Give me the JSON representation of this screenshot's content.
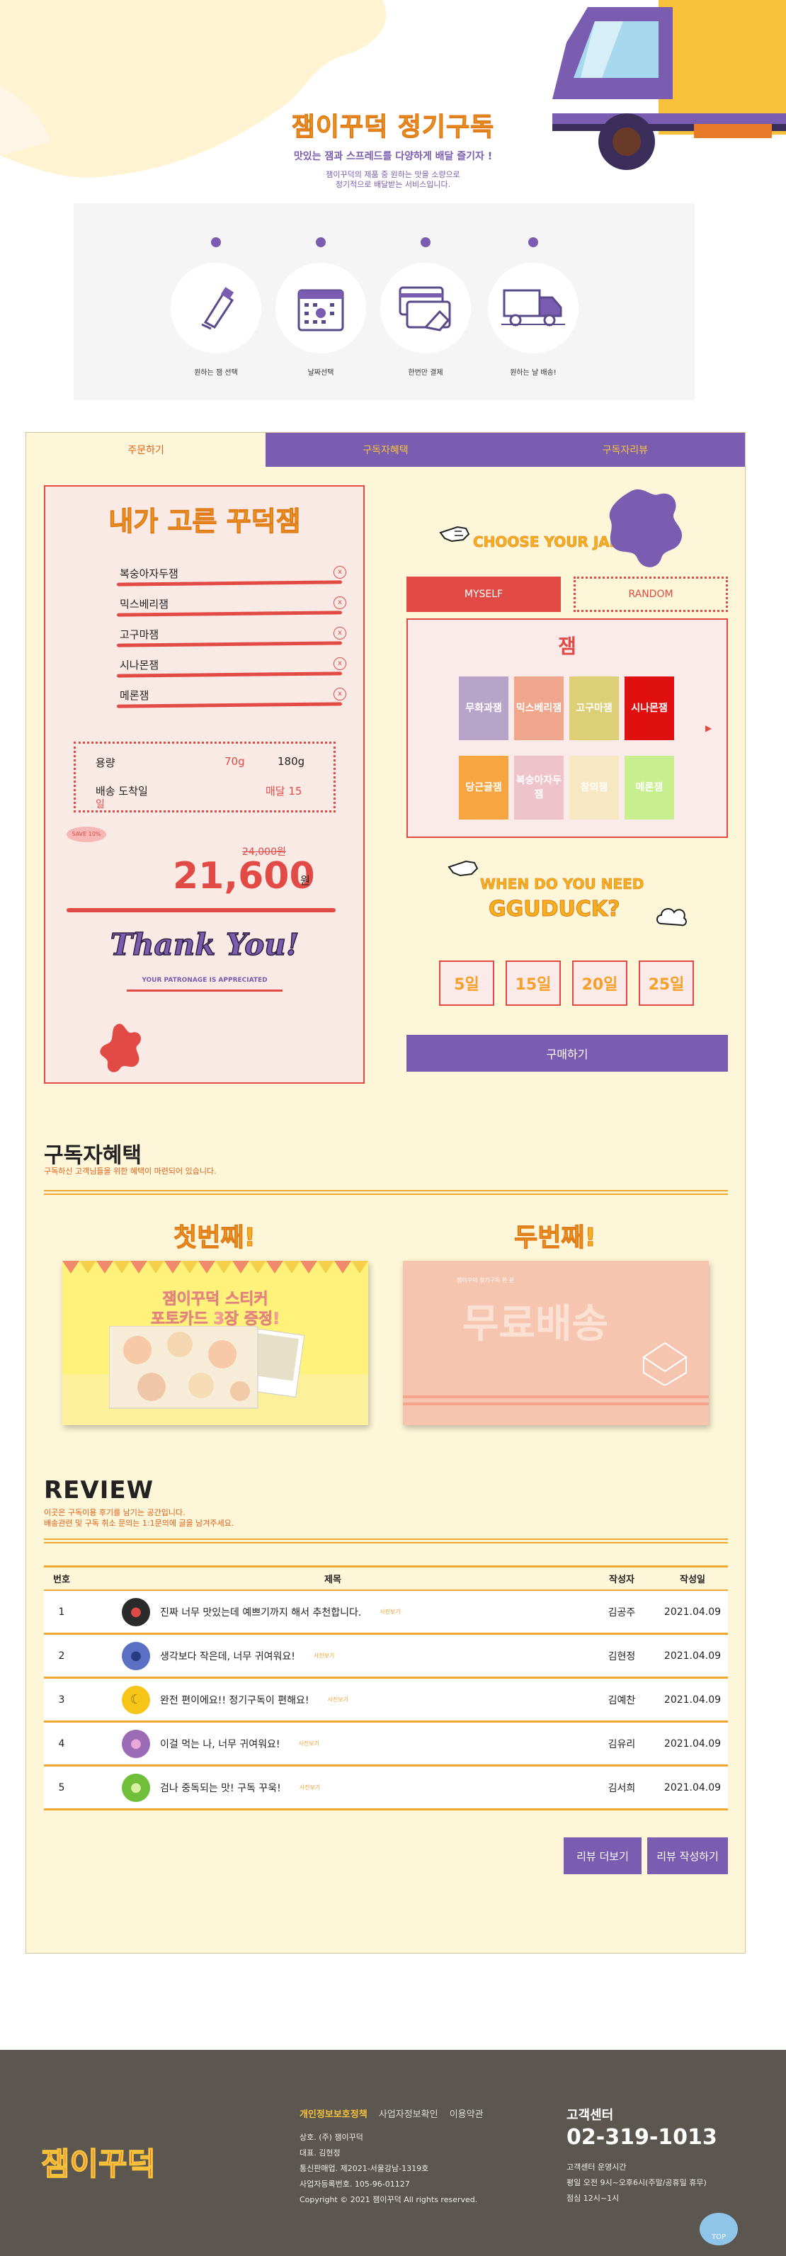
{
  "hero": {
    "title": "잼이꾸덕 정기구독",
    "subtitle": "맛있는 잼과 스프레드를 다양하게 배달 즐기자 !",
    "desc1": "잼이꾸덕의 제품 중 원하는 맛을 소량으로",
    "desc2": "정기적으로 배달받는 서비스입니다."
  },
  "steps": [
    {
      "label": "원하는 잼 선택",
      "icon": "jam-tube-icon"
    },
    {
      "label": "날짜선택",
      "icon": "calendar-icon"
    },
    {
      "label": "한번만 결제",
      "icon": "card-payment-icon"
    },
    {
      "label": "원하는 날 배송!",
      "icon": "truck-icon"
    }
  ],
  "tabs": [
    "주문하기",
    "구독자혜택",
    "구독자리뷰"
  ],
  "order": {
    "card_title": "내가 고른 꾸덕잼",
    "selected": [
      "복숭아자두잼",
      "믹스베리잼",
      "고구마잼",
      "시나몬잼",
      "메론잼"
    ],
    "remove_symbol": "x",
    "capacity_label": "용량",
    "capacity_options": [
      "70g",
      "180g"
    ],
    "delivery_label": "배송 도착일",
    "delivery_value": "매달 15",
    "delivery_unit": "일",
    "save_badge": "SAVE 10%",
    "old_price": "24,000원",
    "price": "21,600",
    "currency": "원",
    "thanks": "Thank You!",
    "thanks_sub": "YOUR PATRONAGE IS APPRECIATED"
  },
  "choose": {
    "title": "CHOOSE YOUR JAM",
    "myself": "MYSELF",
    "random": "RANDOM",
    "box_title": "잼",
    "jams": [
      {
        "label": "무화과잼",
        "color": "#b7a5c9"
      },
      {
        "label": "믹스베리잼",
        "color": "#f0a68c"
      },
      {
        "label": "고구마잼",
        "color": "#dccf78"
      },
      {
        "label": "시나몬잼",
        "color": "#e01010"
      },
      {
        "label": "당근글잼",
        "color": "#f7a540"
      },
      {
        "label": "복숭아자두잼",
        "color": "#efc3cc"
      },
      {
        "label": "참외잼",
        "color": "#f7e7c2"
      },
      {
        "label": "메론잼",
        "color": "#c7ef8d"
      }
    ],
    "next_arrow": "▶"
  },
  "when": {
    "title": "WHEN DO YOU NEED",
    "brand": "GGUDUCK?",
    "days": [
      "5일",
      "15일",
      "20일",
      "25일"
    ],
    "buy": "구매하기"
  },
  "benefits": {
    "title": "구독자혜택",
    "subtitle": "구독하신 고객님들을 위한 혜택이 마련되어 있습니다.",
    "first_title": "첫번째!",
    "first_line1": "잼이꾸덕 스티커",
    "first_line2": "포토카드 3장 증정!",
    "second_title": "두번째!",
    "second_small": "잼이꾸덕 정기구독 한 분",
    "second_big": "무료배송"
  },
  "review": {
    "title": "REVIEW",
    "sub1": "이곳은 구독이용 후기를 남기는 공간입니다.",
    "sub2": "배송관련 및 구독 취소 문의는 1:1문의에 글을 남겨주세요.",
    "headers": [
      "번호",
      "제목",
      "작성자",
      "작성일"
    ],
    "photo_tag": "사진보기",
    "rows": [
      {
        "no": "1",
        "title": "진짜 너무 맛있는데 예쁘기까지 해서 추천합니다.",
        "author": "김공주",
        "date": "2021.04.09",
        "icon": "strawberry-icon",
        "color": "#2b2b2b"
      },
      {
        "no": "2",
        "title": "생각보다 작은데, 너무 귀여워요!",
        "author": "김현정",
        "date": "2021.04.09",
        "icon": "blueberry-icon",
        "color": "#5b6fc4"
      },
      {
        "no": "3",
        "title": "완전 편이에요!! 정기구독이 편해요!",
        "author": "김예찬",
        "date": "2021.04.09",
        "icon": "banana-icon",
        "color": "#f5c518"
      },
      {
        "no": "4",
        "title": "이걸 먹는 나, 너무 귀여워요!",
        "author": "김유리",
        "date": "2021.04.09",
        "icon": "fig-icon",
        "color": "#9b6bb5"
      },
      {
        "no": "5",
        "title": "검나 중독되는 맛! 구독 꾸욱!",
        "author": "김서희",
        "date": "2021.04.09",
        "icon": "kiwi-icon",
        "color": "#6fbf3a"
      }
    ],
    "more": "리뷰 더보기",
    "write": "리뷰 작성하기"
  },
  "footer": {
    "logo": "잼이꾸덕",
    "link_privacy": "개인정보보호정책",
    "link_business": "사업자정보확인",
    "link_terms": "이용약관",
    "info": [
      "상호. (주) 잼이꾸덕",
      "대표. 김현정",
      "통신판매업. 제2021-서울강남-1319호",
      "사업자등록번호. 105-96-01127",
      "Copyright © 2021 잼이꾸덕 All rights reserved."
    ],
    "cs_title": "고객센터",
    "phone": "02-319-1013",
    "hours": [
      "고객센터 운영시간",
      "평일 오전 9시~오후6시(주말/공휴일 휴무)",
      "점심 12시~1시"
    ],
    "top": "TOP"
  }
}
